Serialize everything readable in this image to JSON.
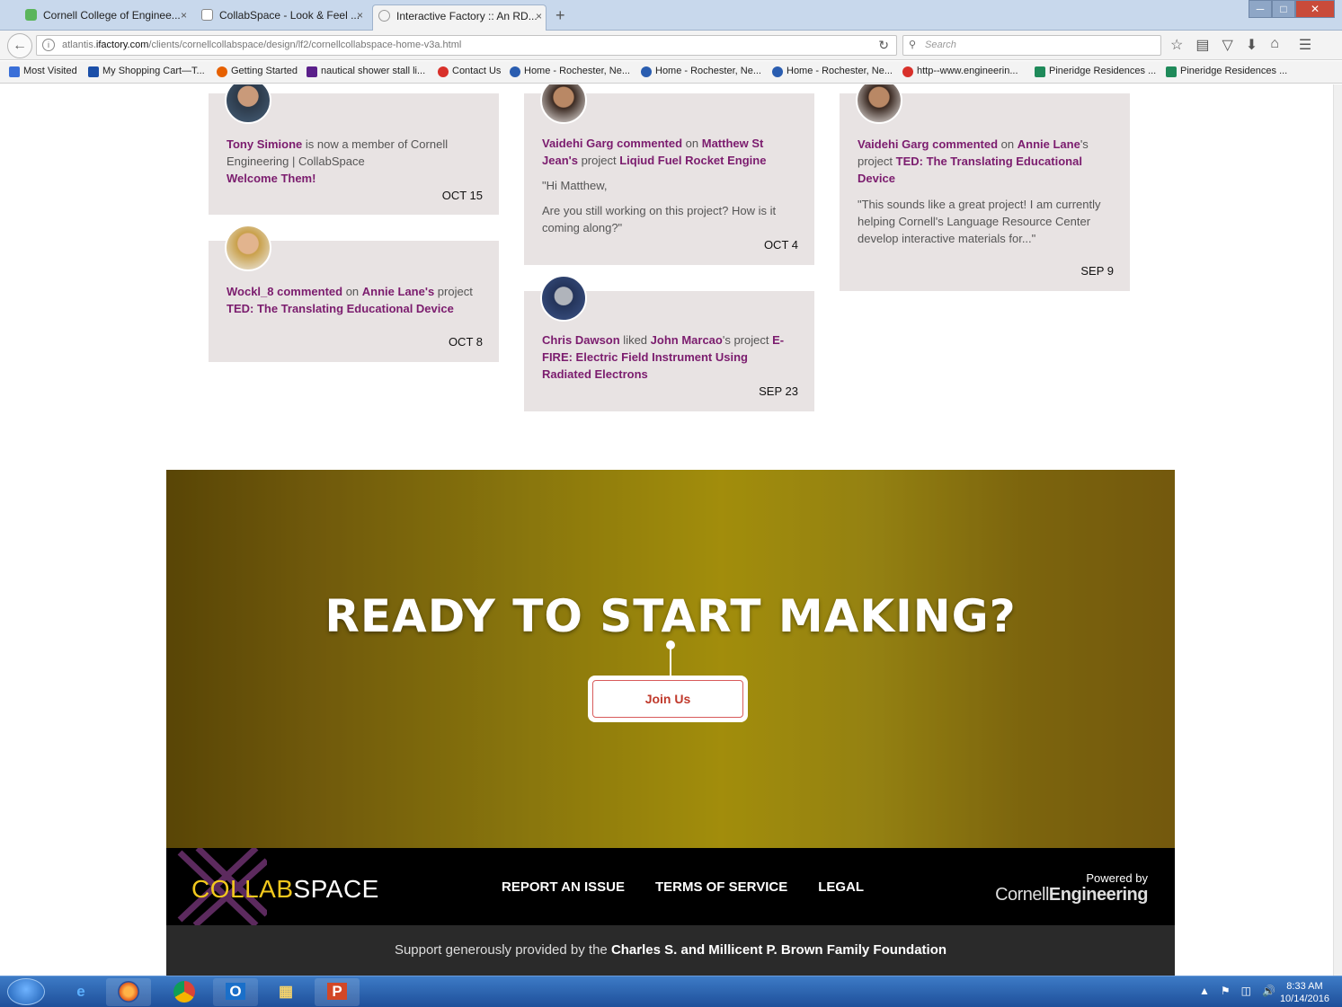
{
  "browser": {
    "tabs": [
      {
        "label": "Cornell College of Enginee...",
        "active": false
      },
      {
        "label": "CollabSpace - Look & Feel ...",
        "active": false
      },
      {
        "label": "Interactive Factory :: An RD...",
        "active": true
      }
    ],
    "tab_close": "×",
    "new_tab": "+",
    "url_prefix": "atlantis.",
    "url_domain": "ifactory.com",
    "url_path": "/clients/cornellcollabspace/design/lf2/cornellcollabspace-home-v3a.html",
    "search_placeholder": "Search",
    "bookmarks": [
      {
        "label": "Most Visited",
        "color": "#3a6fd8"
      },
      {
        "label": "My Shopping Cart—T...",
        "color": "#1b4fa8"
      },
      {
        "label": "Getting Started",
        "color": "#e66000"
      },
      {
        "label": "nautical shower stall li...",
        "color": "#5a1f8a"
      },
      {
        "label": "Contact Us",
        "color": "#d8302a"
      },
      {
        "label": "Home - Rochester, Ne...",
        "color": "#2a5db0"
      },
      {
        "label": "Home - Rochester, Ne...",
        "color": "#2a5db0"
      },
      {
        "label": "Home - Rochester, Ne...",
        "color": "#2a5db0"
      },
      {
        "label": "http--www.engineerin...",
        "color": "#d8302a"
      },
      {
        "label": "Pineridge Residences ...",
        "color": "#1f8a5a"
      },
      {
        "label": "Pineridge Residences ...",
        "color": "#1f8a5a"
      }
    ]
  },
  "activity": {
    "cards": [
      {
        "actor": "Tony Simione",
        "text": " is now a member of Cornell Engineering | CollabSpace",
        "link": "Welcome Them!",
        "date": "OCT 15"
      },
      {
        "actor": "Wockl_8 commented",
        "mid": " on ",
        "owner": "Annie Lane's",
        "pre": " project ",
        "project": "TED: The Translating Educational Device",
        "date": "OCT 8"
      },
      {
        "actor": "Vaidehi Garg commented",
        "mid": " on ",
        "owner": "Matthew St Jean's",
        "pre": " project ",
        "project": "Liqiud Fuel Rocket Engine",
        "quote1": "\"Hi Matthew,",
        "quote2": "Are you still working on this project? How is it coming along?\"",
        "date": "OCT 4"
      },
      {
        "actor": "Chris Dawson",
        "mid": " liked ",
        "owner": "John Marcao",
        "pre": "'s project ",
        "project": "E-FIRE: Electric Field Instrument Using Radiated Electrons",
        "date": "SEP 23"
      },
      {
        "actor": "Vaidehi Garg commented",
        "mid": " on ",
        "owner": "Annie Lane",
        "pre": "'s project ",
        "project": "TED: The Translating Educational Device",
        "quote1": "\"This sounds like a great project! I am currently helping Cornell's Language Resource Center develop interactive materials for...\"",
        "date": "SEP 9"
      }
    ]
  },
  "banner": {
    "headline": "READY TO START MAKING?",
    "button": "Join Us"
  },
  "footer": {
    "logo_a": "COLLAB",
    "logo_b": "SPACE",
    "links": [
      "REPORT AN ISSUE",
      "TERMS OF SERVICE",
      "LEGAL"
    ],
    "powered_by": "Powered by",
    "powered_brand_a": "Cornell",
    "powered_brand_b": "Engineering",
    "support_pre": "Support generously provided by the ",
    "support_name": "Charles S. and Millicent P. Brown Family Foundation"
  },
  "taskbar": {
    "time": "8:33 AM",
    "date": "10/14/2016"
  }
}
